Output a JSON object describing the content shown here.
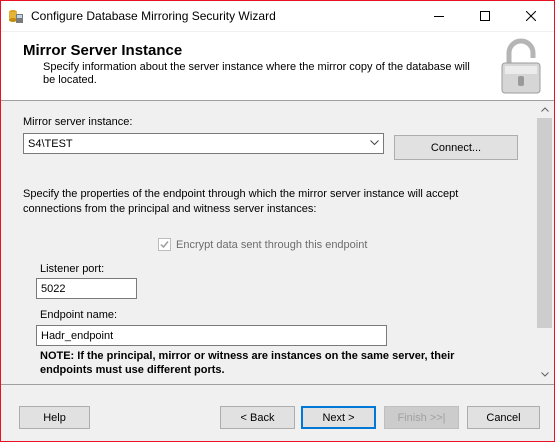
{
  "window": {
    "title": "Configure Database Mirroring Security Wizard",
    "icons": {
      "app": "database-wizard-icon",
      "minimize": "minimize-icon",
      "maximize": "maximize-icon",
      "close": "close-icon"
    },
    "border_color": "#e81123"
  },
  "header": {
    "title": "Mirror Server Instance",
    "description": "Specify information about the server instance where the mirror copy of the database will be located.",
    "icon": "padlock-icon"
  },
  "form": {
    "mirror_instance_label": "Mirror server instance:",
    "mirror_instance_value": "S4\\TEST",
    "connect_label": "Connect...",
    "endpoint_description": "Specify the properties of the endpoint through which the mirror server instance will accept connections from the principal and witness server instances:",
    "encrypt_label": "Encrypt data sent through this endpoint",
    "encrypt_checked": true,
    "encrypt_enabled": false,
    "listener_port_label": "Listener port:",
    "listener_port_value": "5022",
    "endpoint_name_label": "Endpoint name:",
    "endpoint_name_value": "Hadr_endpoint",
    "note": "NOTE: If the principal, mirror or witness are instances on the same server, their endpoints must use different ports."
  },
  "footer": {
    "help_label": "Help",
    "back_label": "< Back",
    "next_label": "Next >",
    "finish_label": "Finish >>|",
    "cancel_label": "Cancel"
  },
  "colors": {
    "accent": "#0078d7",
    "dialog_bg": "#f0f0f0",
    "disabled_text": "#a0a0a0"
  }
}
